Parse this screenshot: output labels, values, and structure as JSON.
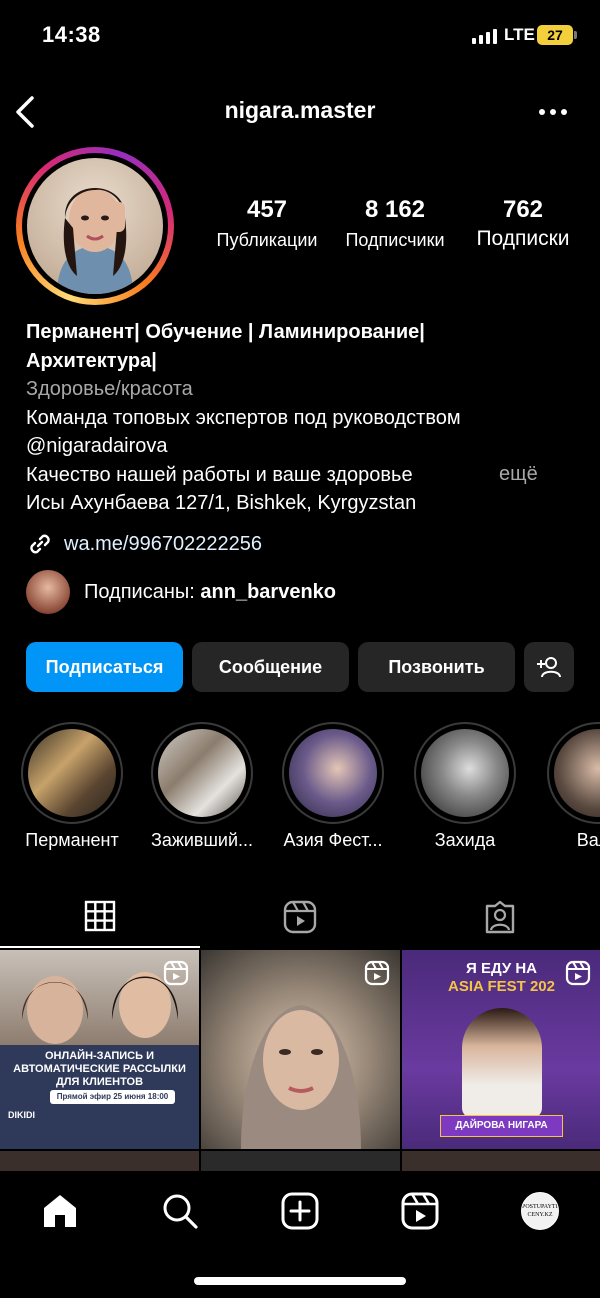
{
  "status": {
    "time": "14:38",
    "network": "LTE",
    "battery": "27"
  },
  "header": {
    "username": "nigara.master"
  },
  "stats": [
    {
      "value": "457",
      "label": "Публикации"
    },
    {
      "value": "8 162",
      "label": "Подписчики"
    },
    {
      "value": "762",
      "label": "Подписки"
    }
  ],
  "bio": {
    "name_line1": "Перманент| Обучение | Ламинирование|",
    "name_line2": "Архитектура|",
    "category": "Здоровье/красота",
    "line1": "Команда топовых экспертов под руководством",
    "line2": "@nigaradairova",
    "line3": "Качество нашей работы и ваше здоровье",
    "more": "ещё",
    "address": "Исы Ахунбаева 127/1, Bishkek, Kyrgyzstan",
    "link": "wa.me/996702222256"
  },
  "followed_by": {
    "prefix": "Подписаны:",
    "user": "ann_barvenko"
  },
  "buttons": {
    "follow": "Подписаться",
    "message": "Сообщение",
    "call": "Позвонить"
  },
  "highlights": [
    "Перманент",
    "Заживший...",
    "Азия Фест...",
    "Захида",
    "Вале"
  ],
  "posts": {
    "post1_title": "ОНЛАЙН-ЗАПИСЬ И АВТОМАТИЧЕСКИЕ РАССЫЛКИ ДЛЯ КЛИЕНТОВ",
    "post1_sub": "Прямой эфир 25 июня 18:00",
    "post1_logo": "DIKIDI",
    "post3_top": "Я ЕДУ НА",
    "post3_fest": "ASIA FEST 202",
    "post3_name": "ДАЙРОВА НИГАРА"
  },
  "nav": {
    "profile_text": "POSTUPAYTE CENY.KZ"
  },
  "colors": {
    "accent": "#0095f6",
    "button_bg": "#262626",
    "link": "#e0f1ff",
    "muted": "#a8a8a8"
  }
}
